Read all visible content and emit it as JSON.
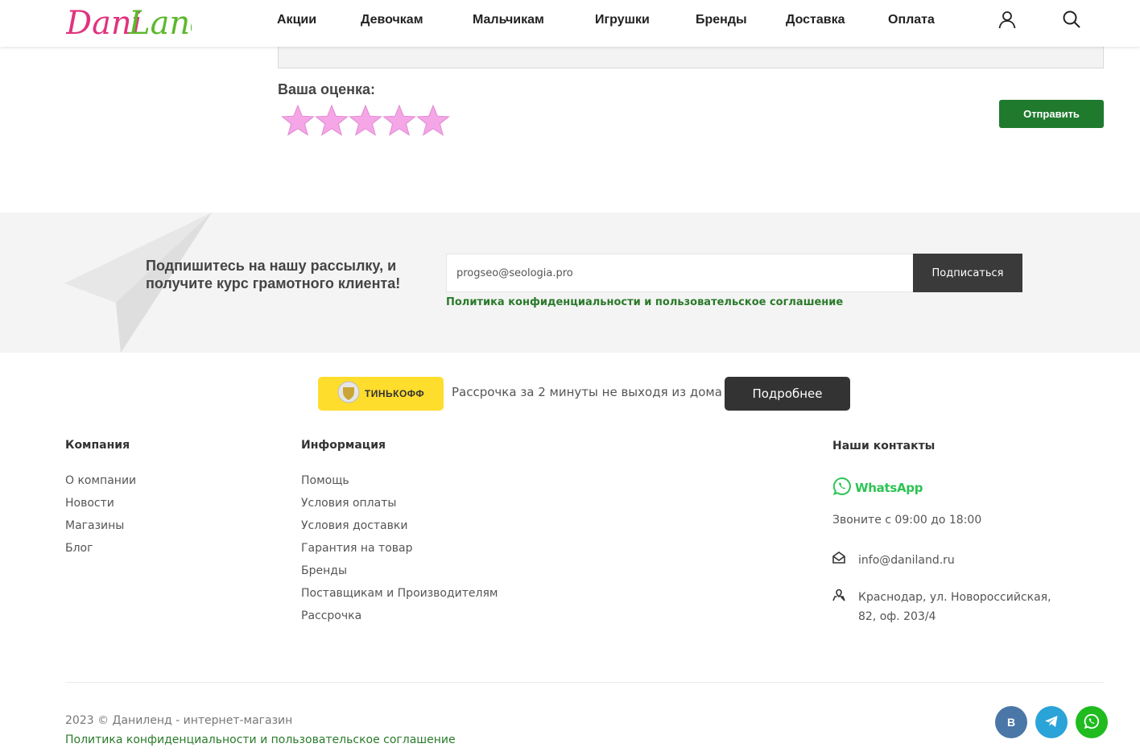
{
  "header": {
    "logo_text": "DaniLand",
    "nav": [
      {
        "label": "Акции"
      },
      {
        "label": "Девочкам"
      },
      {
        "label": "Мальчикам"
      },
      {
        "label": "Игрушки"
      },
      {
        "label": "Бренды"
      },
      {
        "label": "Доставка"
      },
      {
        "label": "Оплата"
      }
    ],
    "icons": [
      "user-icon",
      "search-icon"
    ]
  },
  "review": {
    "rating_label": "Ваша оценка:",
    "stars_total": 5,
    "star_color": "#f4a6e6",
    "submit_label": "Отправить",
    "submit_color": "#1f7a2e"
  },
  "newsletter": {
    "text": "Подпишитесь на нашу рассылку, и получите курс грамотного клиента!",
    "email_value": "progseo@seologia.pro",
    "subscribe_label": "Подписаться",
    "policy_link": "Политика конфиденциальности и пользовательское соглашение"
  },
  "installment": {
    "badge_label": "ТИНЬКОФФ",
    "text": "Рассрочка за 2 минуты не выходя из дома",
    "button_label": "Подробнее"
  },
  "footer": {
    "company": {
      "title": "Компания",
      "links": [
        "О компании",
        "Новости",
        "Магазины",
        "Блог"
      ]
    },
    "info": {
      "title": "Информация",
      "links": [
        "Помощь",
        "Условия оплаты",
        "Условия доставки",
        "Гарантия на товар",
        "Бренды",
        "Поставщикам и Производителям",
        "Рассрочка"
      ]
    },
    "contacts": {
      "title": "Наши контакты",
      "whatsapp_label": "WhatsApp",
      "hours": "Звоните с 09:00 до 18:00",
      "email": "info@daniland.ru",
      "address": "Краснодар, ул. Новороссийская, 82, оф. 203/4"
    },
    "copyright": "2023 © Даниленд - интернет-магазин",
    "policy_link": "Политика конфиденциальности и пользовательское соглашение",
    "social": [
      {
        "name": "vk",
        "label": "В",
        "color": "#4a76a8"
      },
      {
        "name": "telegram",
        "label": "",
        "color": "#2aa3d8"
      },
      {
        "name": "whatsapp",
        "label": "",
        "color": "#1fbb1f"
      }
    ]
  }
}
